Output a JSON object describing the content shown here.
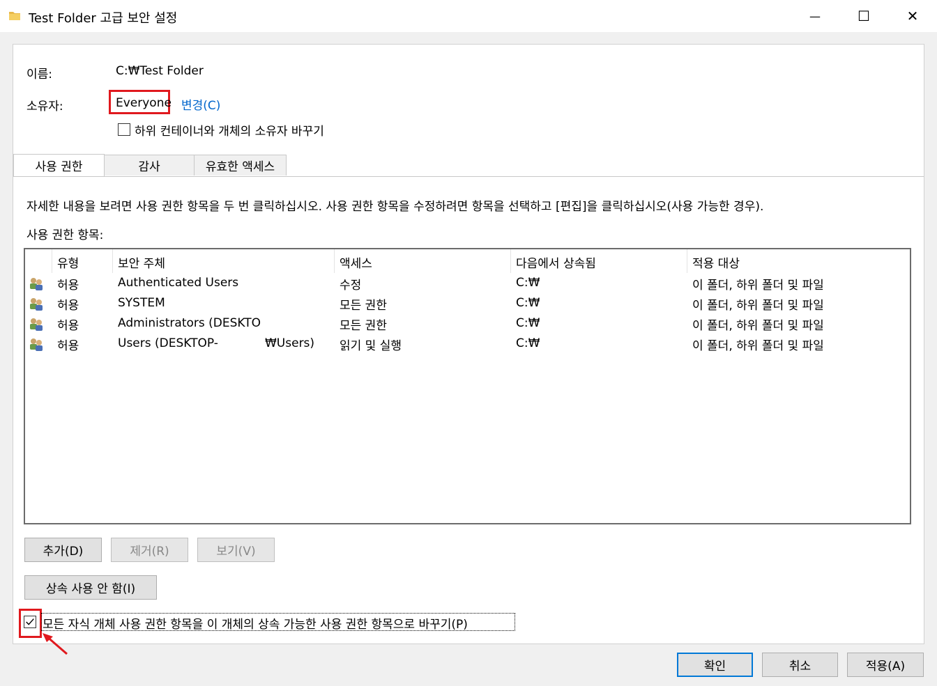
{
  "window": {
    "title": "Test Folder 고급 보안 설정",
    "minimize_glyph": "—",
    "maximize_glyph": "☐",
    "close_glyph": "✕"
  },
  "info": {
    "name_label": "이름:",
    "name_value": "C:₩Test Folder",
    "owner_label": "소유자:",
    "owner_value": "Everyone",
    "change_link": "변경(C)",
    "replace_owner_label": "하위 컨테이너와 개체의 소유자 바꾸기"
  },
  "tabs": [
    {
      "label": "사용 권한",
      "active": true
    },
    {
      "label": "감사",
      "active": false
    },
    {
      "label": "유효한 액세스",
      "active": false
    }
  ],
  "description": "자세한 내용을 보려면 사용 권한 항목을 두 번 클릭하십시오. 사용 권한 항목을 수정하려면 항목을 선택하고 [편집]을 클릭하십시오(사용 가능한 경우).",
  "entries_label": "사용 권한 항목:",
  "table": {
    "columns": [
      "유형",
      "보안 주체",
      "액세스",
      "다음에서 상속됨",
      "적용 대상"
    ],
    "rows": [
      {
        "type": "허용",
        "principal": "Authenticated Users",
        "access": "수정",
        "inherited": "C:₩",
        "applies": "이 폴더, 하위 폴더 및 파일"
      },
      {
        "type": "허용",
        "principal": "SYSTEM",
        "access": "모든 권한",
        "inherited": "C:₩",
        "applies": "이 폴더, 하위 폴더 및 파일"
      },
      {
        "type": "허용",
        "principal": "Administrators (DESKTOP-",
        "access": "모든 권한",
        "inherited": "C:₩",
        "applies": "이 폴더, 하위 폴더 및 파일"
      },
      {
        "type": "허용",
        "principal": "Users (DESKTOP-",
        "principal_suffix": "₩Users)",
        "access": "읽기 및 실행",
        "inherited": "C:₩",
        "applies": "이 폴더, 하위 폴더 및 파일"
      }
    ]
  },
  "buttons": {
    "add": "추가(D)",
    "remove": "제거(R)",
    "view": "보기(V)",
    "disable_inheritance": "상속 사용 안 함(I)"
  },
  "replace_child_label": "모든 자식 개체 사용 권한 항목을 이 개체의 상속 가능한 사용 권한 항목으로 바꾸기(P)",
  "replace_child_checked": true,
  "footer": {
    "ok": "확인",
    "cancel": "취소",
    "apply": "적용(A)"
  },
  "colors": {
    "highlight": "#e0191e",
    "link": "#0066cc",
    "accent": "#0078d7"
  }
}
